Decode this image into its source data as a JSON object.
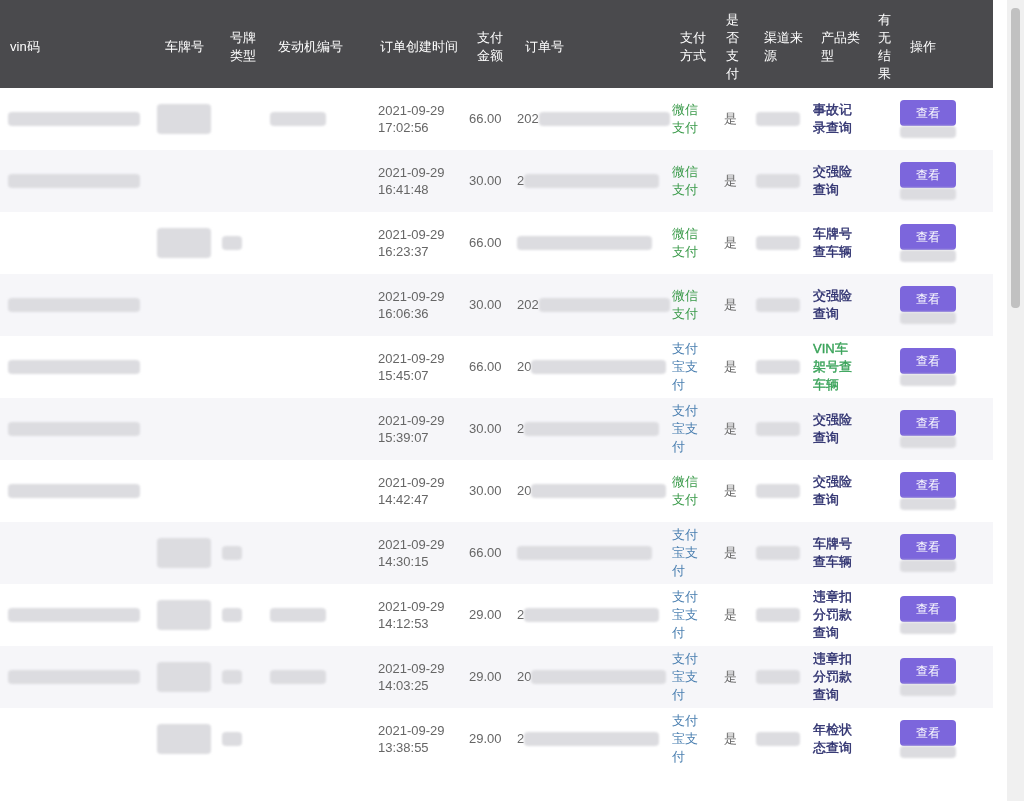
{
  "table": {
    "columns": [
      "vin码",
      "车牌号",
      "号牌类型",
      "发动机编号",
      "订单创建时间",
      "支付金额",
      "订单号",
      "支付方式",
      "是否支付",
      "渠道来源",
      "产品类型",
      "有无结果",
      "操作"
    ],
    "rows": [
      {
        "masks": {
          "vin": true,
          "plate": true,
          "plate_type": false,
          "engine": true
        },
        "created": "2021-09-29 17:02:56",
        "amount": "66.00",
        "order_prefix": "202",
        "payment": {
          "kind": "wechat",
          "text": "微信支付"
        },
        "paid": "是",
        "product": {
          "text": "事故记录查询",
          "color": "#2c2f6e"
        },
        "action": "查看"
      },
      {
        "masks": {
          "vin": true,
          "plate": false,
          "plate_type": false,
          "engine": false
        },
        "created": "2021-09-29 16:41:48",
        "amount": "30.00",
        "order_prefix": "2",
        "payment": {
          "kind": "wechat",
          "text": "微信支付"
        },
        "paid": "是",
        "product": {
          "text": "交强险查询",
          "color": "#2c2f6e"
        },
        "action": "查看"
      },
      {
        "masks": {
          "vin": false,
          "plate": true,
          "plate_type": true,
          "engine": false
        },
        "created": "2021-09-29 16:23:37",
        "amount": "66.00",
        "payment": {
          "kind": "wechat",
          "text": "微信支付"
        },
        "paid": "是",
        "product": {
          "text": "车牌号查车辆",
          "color": "#2c2f6e"
        },
        "action": "查看"
      },
      {
        "masks": {
          "vin": true,
          "plate": false,
          "plate_type": false,
          "engine": false
        },
        "created": "2021-09-29 16:06:36",
        "amount": "30.00",
        "order_prefix": "202",
        "payment": {
          "kind": "wechat",
          "text": "微信支付"
        },
        "paid": "是",
        "product": {
          "text": "交强险查询",
          "color": "#2c2f6e"
        },
        "action": "查看"
      },
      {
        "masks": {
          "vin": true,
          "plate": false,
          "plate_type": false,
          "engine": false
        },
        "created": "2021-09-29 15:45:07",
        "amount": "66.00",
        "order_prefix": "20",
        "payment": {
          "kind": "alipay",
          "text": "支付宝支付"
        },
        "paid": "是",
        "product": {
          "text": "VIN车架号查车辆",
          "color": "#3aa35a"
        },
        "action": "查看"
      },
      {
        "masks": {
          "vin": true,
          "plate": false,
          "plate_type": false,
          "engine": false
        },
        "created": "2021-09-29 15:39:07",
        "amount": "30.00",
        "order_prefix": "2",
        "payment": {
          "kind": "alipay",
          "text": "支付宝支付"
        },
        "paid": "是",
        "product": {
          "text": "交强险查询",
          "color": "#2c2f6e"
        },
        "action": "查看"
      },
      {
        "masks": {
          "vin": true,
          "plate": false,
          "plate_type": false,
          "engine": false
        },
        "created": "2021-09-29 14:42:47",
        "amount": "30.00",
        "order_prefix": "20",
        "payment": {
          "kind": "wechat",
          "text": "微信支付"
        },
        "paid": "是",
        "product": {
          "text": "交强险查询",
          "color": "#2c2f6e"
        },
        "action": "查看"
      },
      {
        "masks": {
          "vin": false,
          "plate": true,
          "plate_type": true,
          "engine": false
        },
        "created": "2021-09-29 14:30:15",
        "amount": "66.00",
        "payment": {
          "kind": "alipay",
          "text": "支付宝支付"
        },
        "paid": "是",
        "product": {
          "text": "车牌号查车辆",
          "color": "#2c2f6e"
        },
        "action": "查看"
      },
      {
        "masks": {
          "vin": true,
          "plate": true,
          "plate_type": true,
          "engine": true
        },
        "created": "2021-09-29 14:12:53",
        "amount": "29.00",
        "order_prefix": "2",
        "payment": {
          "kind": "alipay",
          "text": "支付宝支付"
        },
        "paid": "是",
        "product": {
          "text": "违章扣分罚款查询",
          "color": "#2c2f6e"
        },
        "action": "查看"
      },
      {
        "masks": {
          "vin": true,
          "plate": true,
          "plate_type": true,
          "engine": true
        },
        "created": "2021-09-29 14:03:25",
        "amount": "29.00",
        "order_prefix": "20",
        "payment": {
          "kind": "alipay",
          "text": "支付宝支付"
        },
        "paid": "是",
        "product": {
          "text": "违章扣分罚款查询",
          "color": "#2c2f6e"
        },
        "action": "查看"
      },
      {
        "masks": {
          "vin": false,
          "plate": true,
          "plate_type": true,
          "engine": false
        },
        "created": "2021-09-29 13:38:55",
        "amount": "29.00",
        "order_prefix": "2",
        "payment": {
          "kind": "alipay",
          "text": "支付宝支付"
        },
        "paid": "是",
        "product": {
          "text": "年检状态查询",
          "color": "#2c2f6e"
        },
        "action": "查看"
      }
    ]
  }
}
